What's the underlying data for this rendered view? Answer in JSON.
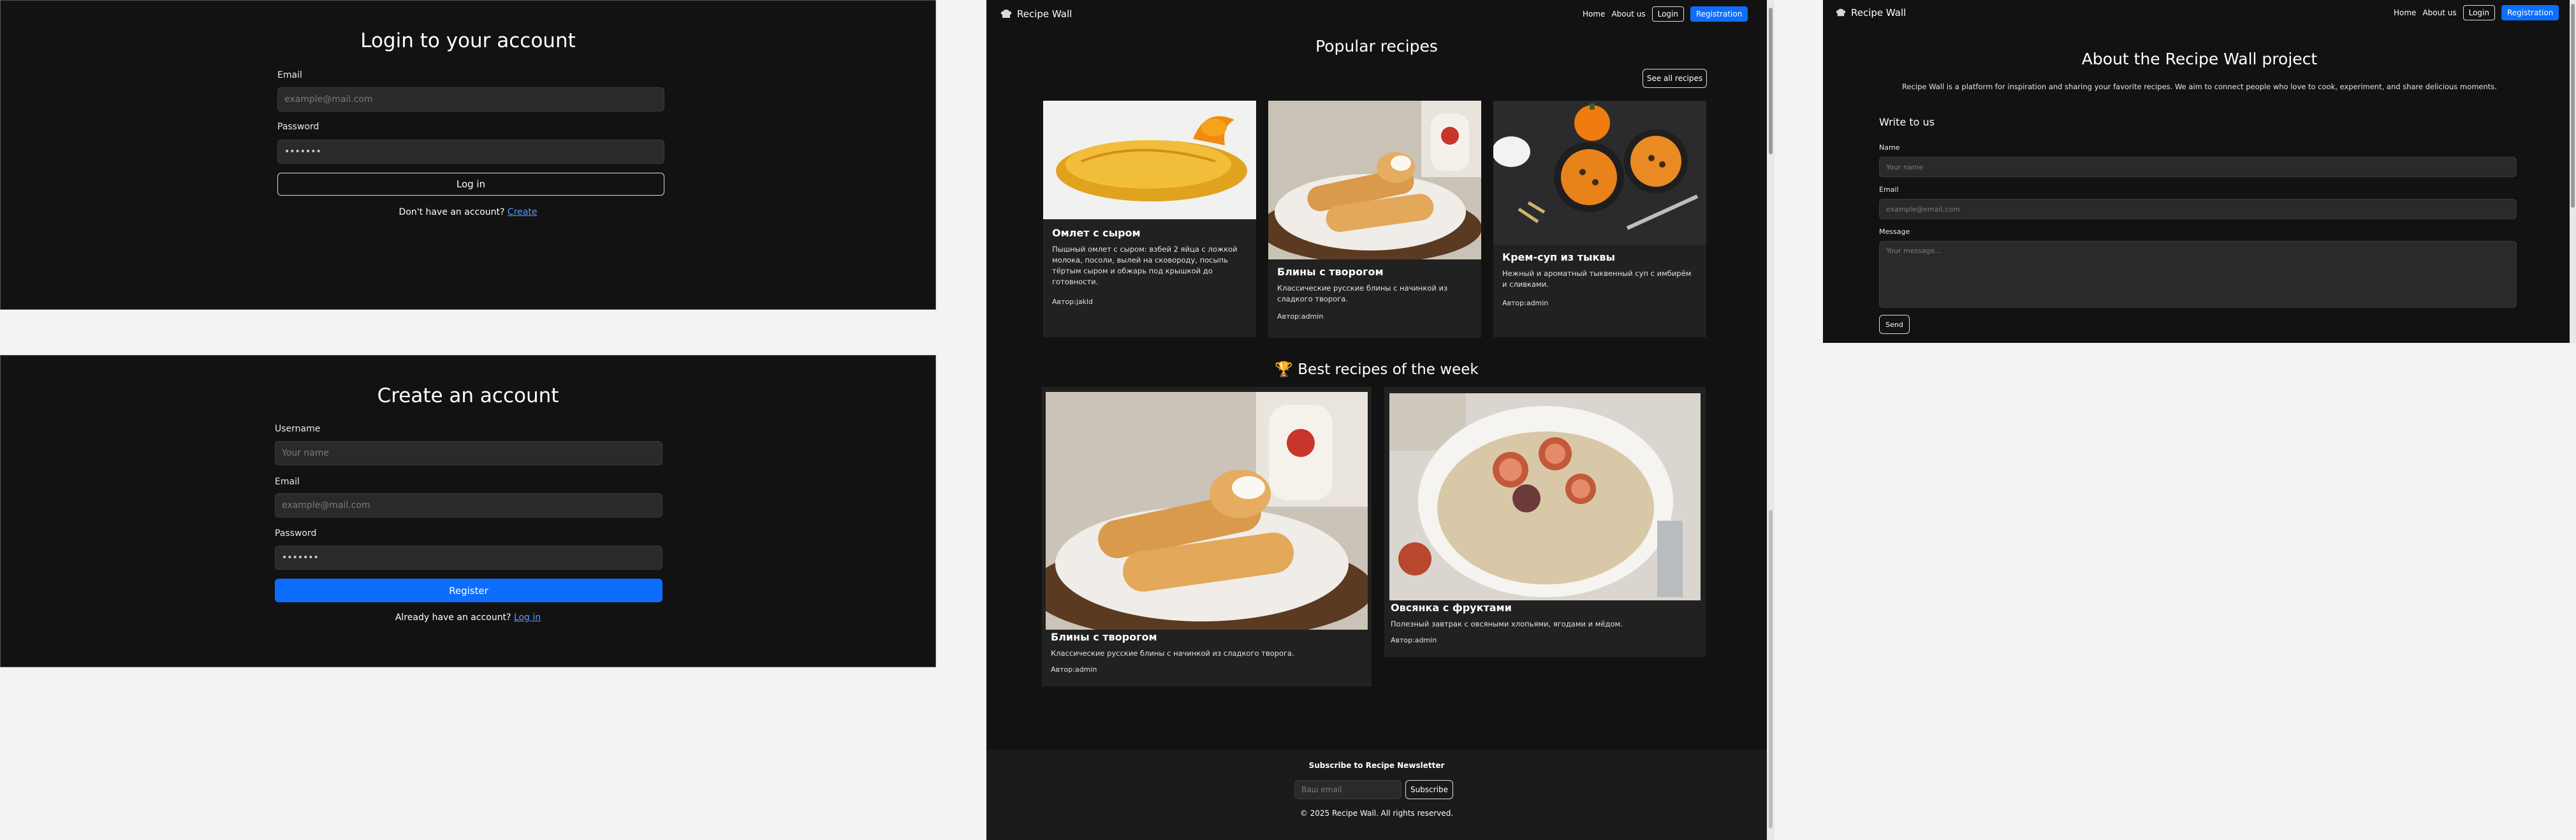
{
  "login": {
    "title": "Login to your account",
    "email_label": "Email",
    "email_placeholder": "example@mail.com",
    "password_label": "Password",
    "password_value": "•••••••",
    "submit": "Log in",
    "footer_text": "Don't have an account?",
    "footer_link": "Create"
  },
  "register": {
    "title": "Create an account",
    "username_label": "Username",
    "username_placeholder": "Your name",
    "email_label": "Email",
    "email_placeholder": "example@mail.com",
    "password_label": "Password",
    "password_value": "•••••••",
    "submit": "Register",
    "footer_text": "Already have an account?",
    "footer_link": "Log in"
  },
  "nav": {
    "brand": "Recipe Wall",
    "home": "Home",
    "about": "About us",
    "login": "Login",
    "registration": "Registration"
  },
  "main": {
    "popular_title": "Popular recipes",
    "see_all": "See all recipes",
    "popular": [
      {
        "title": "Омлет с сыром",
        "desc": "Пышный омлет с сыром: взбей 2 яйца с ложкой молока, посоли, вылей на сковороду, посыпь тёртым сыром и обжарь под крышкой до готовности.",
        "author": "Автор:jakld",
        "image": "omelette"
      },
      {
        "title": "Блины с творогом",
        "desc": "Классические русские блины с начинкой из сладкого творога.",
        "author": "Автор:admin",
        "image": "blini"
      },
      {
        "title": "Крем-суп из тыквы",
        "desc": "Нежный и ароматный тыквенный суп с имбирём и сливками.",
        "author": "Автор:admin",
        "image": "pumpkin-soup"
      }
    ],
    "best_icon": "🏆",
    "best_title": "Best recipes of the week",
    "best": [
      {
        "title": "Блины с творогом",
        "desc": "Классические русские блины с начинкой из сладкого творога.",
        "author": "Автор:admin",
        "image": "blini"
      },
      {
        "title": "Овсянка с фруктами",
        "desc": "Полезный завтрак с овсяными хлопьями, ягодами и мёдом.",
        "author": "Автор:admin",
        "image": "oatmeal"
      }
    ],
    "newsletter_title": "Subscribe to Recipe Newsletter",
    "newsletter_placeholder": "Ваш email",
    "subscribe": "Subscribe",
    "copyright": "© 2025 Recipe Wall. All rights reserved."
  },
  "about": {
    "title": "About the Recipe Wall project",
    "text": "Recipe Wall is a platform for inspiration and sharing your favorite recipes. We aim to connect people who love to cook, experiment, and share delicious moments.",
    "write_title": "Write to us",
    "name_label": "Name",
    "name_placeholder": "Your name",
    "email_label": "Email",
    "email_placeholder": "example@email.com",
    "message_label": "Message",
    "message_placeholder": "Your message...",
    "send": "Send"
  },
  "colors": {
    "page_bg": "#f3f3f3",
    "panel_bg": "#121212",
    "card_bg": "#212121",
    "accent": "#0d6efd"
  }
}
